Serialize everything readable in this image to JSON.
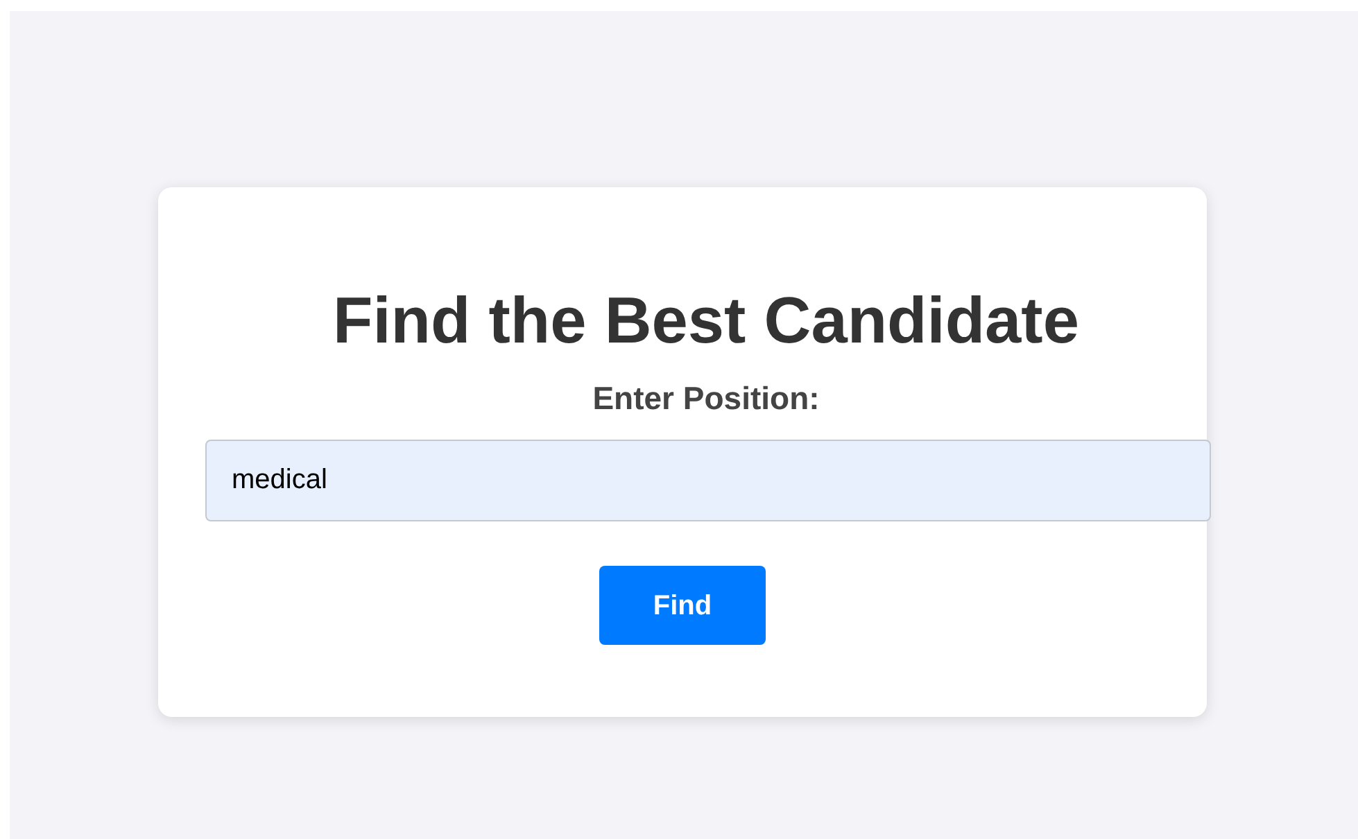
{
  "card": {
    "title": "Find the Best Candidate",
    "field": {
      "label": "Enter Position:",
      "value": "medical"
    },
    "button": "Find"
  }
}
